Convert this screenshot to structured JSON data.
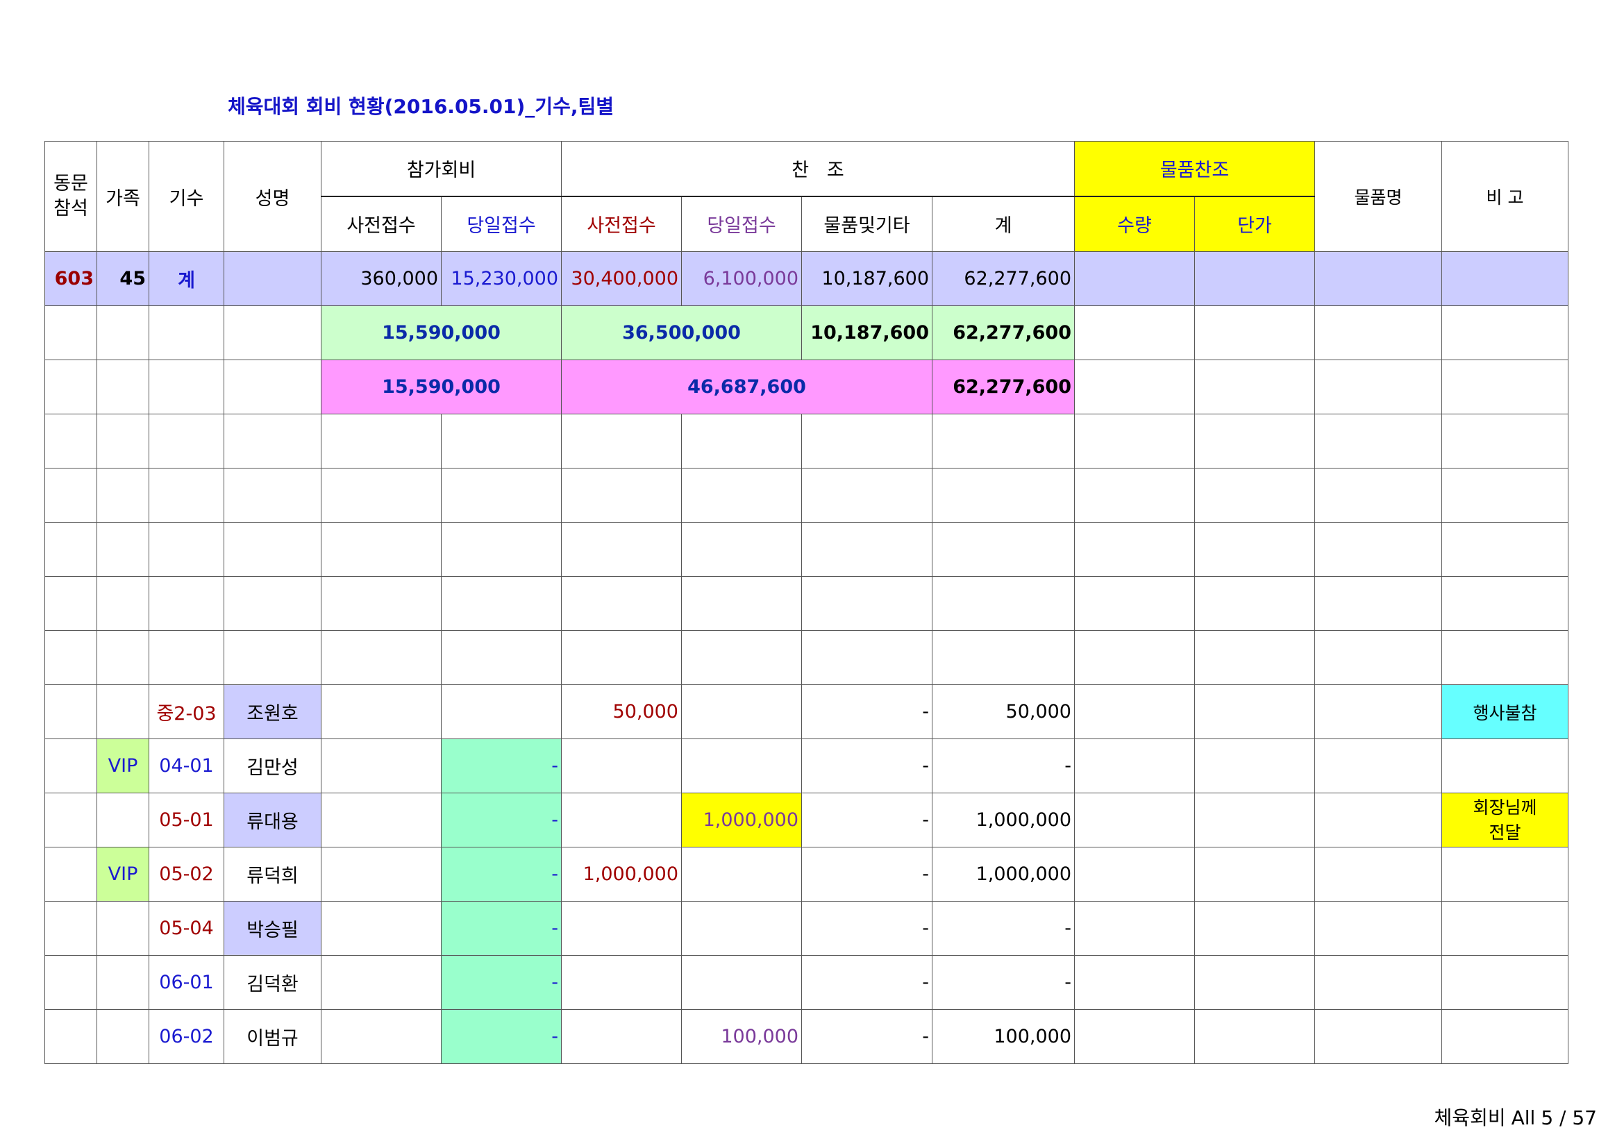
{
  "title": "체육대회 회비 현황(2016.05.01)_기수,팀별",
  "header": {
    "col_attend": "동문\n참석",
    "col_family": "가족",
    "col_gen": "기수",
    "col_name": "성명",
    "group_fee": "참가회비",
    "group_sponsor": "찬   조",
    "group_goods": "물품찬조",
    "col_goods_name": "물품명",
    "col_note": "비 고",
    "fee_pre": "사전접수",
    "fee_day": "당일접수",
    "sp_pre": "사전접수",
    "sp_day": "당일접수",
    "sp_goods": "물품및기타",
    "sp_total": "계",
    "qty": "수량",
    "price": "단가"
  },
  "summary": {
    "attend": "603",
    "family": "45",
    "label": "계",
    "fee_pre": "360,000",
    "fee_day": "15,230,000",
    "sp_pre": "30,400,000",
    "sp_day": "6,100,000",
    "sp_goods": "10,187,600",
    "total": "62,277,600"
  },
  "subtotal1": {
    "fee": "15,590,000",
    "sponsor": "36,500,000",
    "goods": "10,187,600",
    "total": "62,277,600"
  },
  "subtotal2": {
    "fee": "15,590,000",
    "sponsor": "46,687,600",
    "total": "62,277,600"
  },
  "rows": [
    {
      "family": "",
      "gen": "중2-03",
      "name": "조원호",
      "fee_day": "",
      "sp_pre": "50,000",
      "sp_day": "",
      "goods": "-",
      "total": "50,000",
      "note": "행사불참"
    },
    {
      "family": "VIP",
      "gen": "04-01",
      "name": "김만성",
      "fee_day": "-",
      "sp_pre": "",
      "sp_day": "",
      "goods": "-",
      "total": "-",
      "note": ""
    },
    {
      "family": "",
      "gen": "05-01",
      "name": "류대용",
      "fee_day": "-",
      "sp_pre": "",
      "sp_day": "1,000,000",
      "goods": "-",
      "total": "1,000,000",
      "note": "회장님께 전달"
    },
    {
      "family": "VIP",
      "gen": "05-02",
      "name": "류덕희",
      "fee_day": "-",
      "sp_pre": "1,000,000",
      "sp_day": "",
      "goods": "-",
      "total": "1,000,000",
      "note": ""
    },
    {
      "family": "",
      "gen": "05-04",
      "name": "박승필",
      "fee_day": "-",
      "sp_pre": "",
      "sp_day": "",
      "goods": "-",
      "total": "-",
      "note": ""
    },
    {
      "family": "",
      "gen": "06-01",
      "name": "김덕환",
      "fee_day": "-",
      "sp_pre": "",
      "sp_day": "",
      "goods": "-",
      "total": "-",
      "note": ""
    },
    {
      "family": "",
      "gen": "06-02",
      "name": "이범규",
      "fee_day": "-",
      "sp_pre": "",
      "sp_day": "100,000",
      "goods": "-",
      "total": "100,000",
      "note": ""
    }
  ],
  "footer": {
    "sheet": "체육회비",
    "scope": "All",
    "page": "5 / 57"
  }
}
